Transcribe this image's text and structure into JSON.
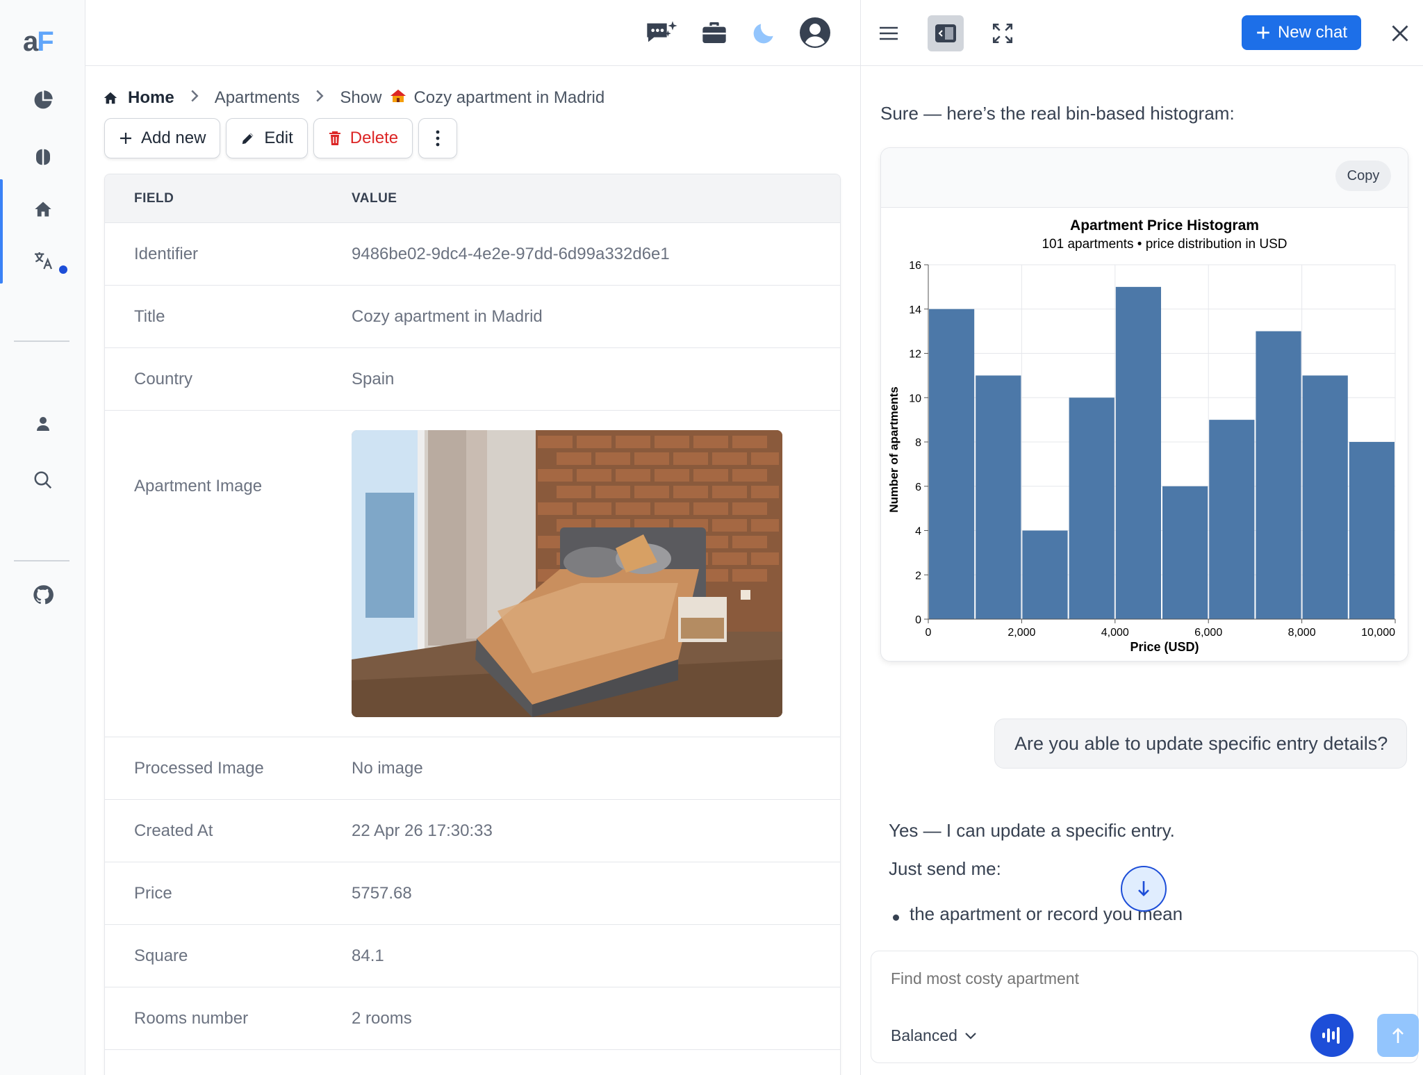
{
  "breadcrumb": {
    "home": "Home",
    "section": "Apartments",
    "show": "Show",
    "current": "Cozy apartment in Madrid"
  },
  "actions": {
    "add": "Add new",
    "edit": "Edit",
    "delete": "Delete"
  },
  "table": {
    "headers": {
      "field": "FIELD",
      "value": "VALUE"
    },
    "rows": [
      {
        "field": "Identifier",
        "value": "9486be02-9dc4-4e2e-97dd-6d99a332d6e1"
      },
      {
        "field": "Title",
        "value": "Cozy apartment in Madrid"
      },
      {
        "field": "Country",
        "value": "Spain"
      },
      {
        "field": "Apartment Image",
        "value": ""
      },
      {
        "field": "Processed Image",
        "value": "No image"
      },
      {
        "field": "Created At",
        "value": "22 Apr 26 17:30:33"
      },
      {
        "field": "Price",
        "value": "5757.68"
      },
      {
        "field": "Square",
        "value": "84.1"
      },
      {
        "field": "Rooms number",
        "value": "2 rooms"
      }
    ]
  },
  "chat": {
    "new_chat": "New chat",
    "intro": "Sure — here’s the real bin-based histogram:",
    "copy": "Copy",
    "question": "Are you able to update specific entry details?",
    "answer_1": "Yes — I can update a specific entry.",
    "answer_2": "Just send me:",
    "bullet_1": "the apartment or record you mean",
    "composer_placeholder": "Find most costy apartment",
    "mode": "Balanced"
  },
  "chart_data": {
    "type": "bar",
    "title": "Apartment Price Histogram",
    "subtitle": "101 apartments • price distribution in USD",
    "xlabel": "Price (USD)",
    "ylabel": "Number of apartments",
    "bins": [
      [
        0,
        1000
      ],
      [
        1000,
        2000
      ],
      [
        2000,
        3000
      ],
      [
        3000,
        4000
      ],
      [
        4000,
        5000
      ],
      [
        5000,
        6000
      ],
      [
        6000,
        7000
      ],
      [
        7000,
        8000
      ],
      [
        8000,
        9000
      ],
      [
        9000,
        10000
      ]
    ],
    "values": [
      14,
      11,
      4,
      10,
      15,
      6,
      9,
      13,
      11,
      8
    ],
    "xlim": [
      0,
      10000
    ],
    "ylim": [
      0,
      16
    ],
    "x_ticks": [
      0,
      2000,
      4000,
      6000,
      8000,
      10000
    ],
    "x_tick_labels": [
      "0",
      "2,000",
      "4,000",
      "6,000",
      "8,000",
      "10,000"
    ],
    "y_ticks": [
      0,
      2,
      4,
      6,
      8,
      10,
      12,
      14,
      16
    ],
    "grid": true,
    "bar_color": "#4c78a8"
  },
  "colors": {
    "accent": "#1d6fe8",
    "danger": "#dc2626",
    "bar": "#4c78a8"
  }
}
